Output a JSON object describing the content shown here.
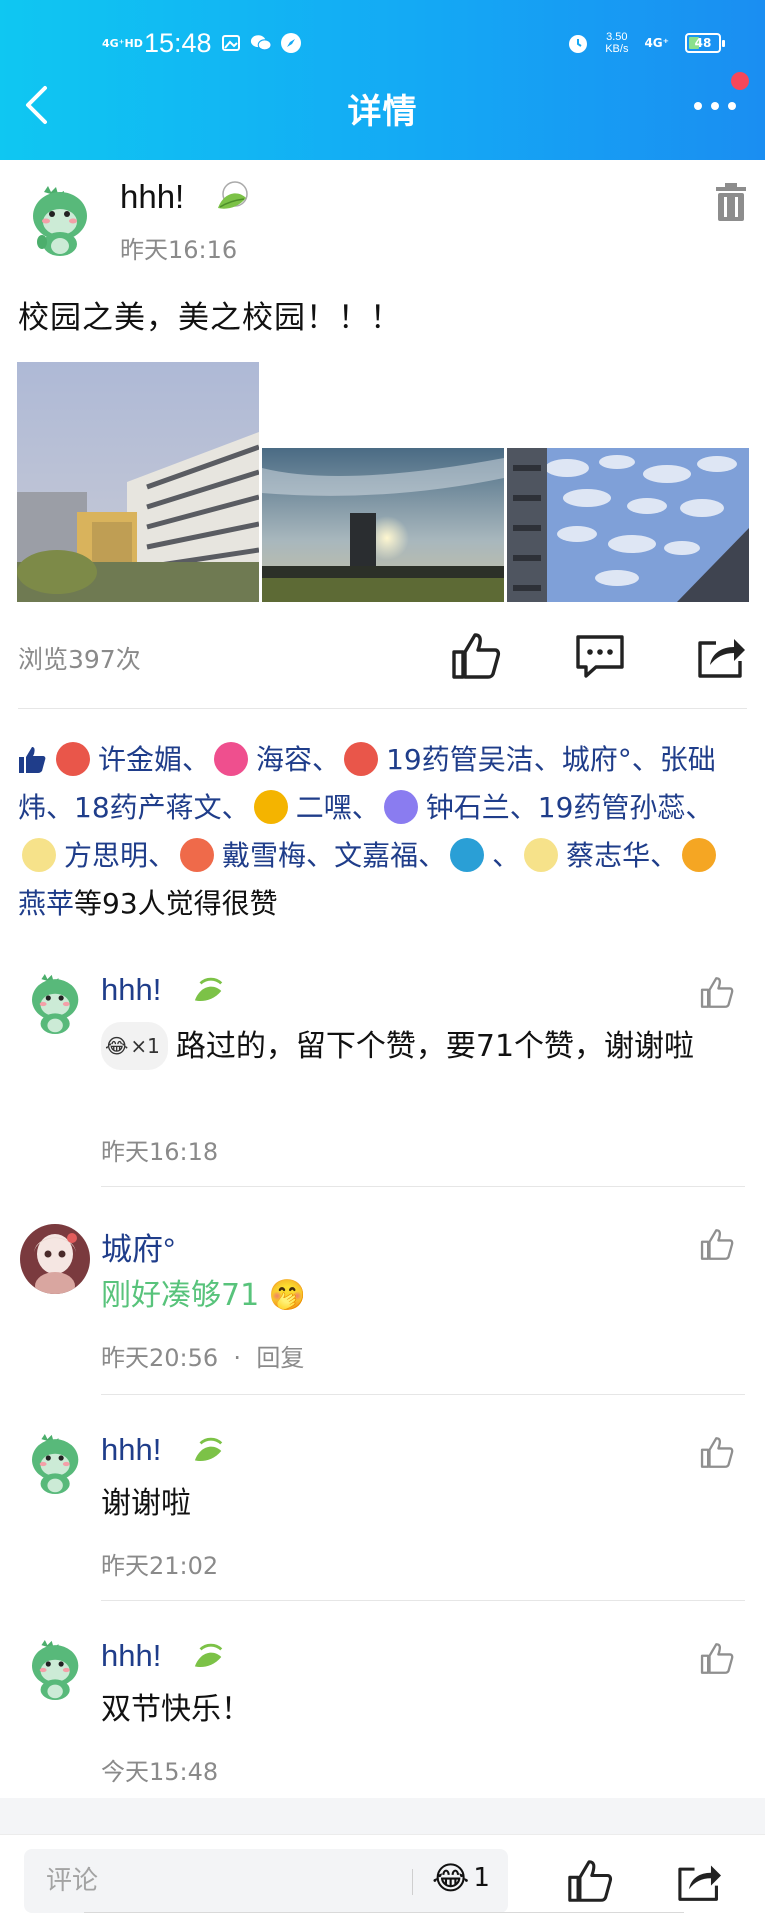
{
  "status_bar": {
    "signal": "4G⁺HD",
    "time": "15:48",
    "speed_value": "3.50",
    "speed_unit": "KB/s",
    "network": "4G⁺",
    "battery": "48"
  },
  "nav": {
    "title": "详情",
    "back_icon": "chevron-left-icon",
    "more_icon": "more-dots-icon",
    "has_notification_dot": true
  },
  "colors": {
    "header_gradient": [
      "#0fc7f2",
      "#1a8ef2"
    ],
    "link_blue": "#1f3d8a",
    "green_comment": "#58c37b",
    "notification_red": "#f6475a",
    "meta_gray": "#8a8a8a"
  },
  "post": {
    "author": "hhh!",
    "time": "昨天16:16",
    "text": "校园之美，美之校园！！！",
    "photo_count": 3,
    "views": "浏览397次"
  },
  "likes": {
    "names": [
      {
        "name": "许金媚",
        "avatar_color": "#e9564a"
      },
      {
        "name": "海容",
        "avatar_color": "#ef4f8e"
      },
      {
        "name": "19药管吴洁",
        "avatar_color": "#e9564a"
      },
      {
        "name": "城府°",
        "avatar_color": ""
      },
      {
        "name": "张础炜",
        "avatar_color": ""
      },
      {
        "name": "18药产蒋文",
        "avatar_color": ""
      },
      {
        "name": "二嘿",
        "avatar_color": "#f4b400"
      },
      {
        "name": "钟石兰",
        "avatar_color": "#8a7cf0"
      },
      {
        "name": "19药管孙蕊",
        "avatar_color": ""
      },
      {
        "name": "方思明",
        "avatar_color": "#f6e28a"
      },
      {
        "name": "戴雪梅",
        "avatar_color": "#ef6a4a"
      },
      {
        "name": "文嘉福",
        "avatar_color": ""
      },
      {
        "name": "",
        "avatar_color": "#2a9fd6"
      },
      {
        "name": "蔡志华",
        "avatar_color": "#f6e28a"
      },
      {
        "name": "燕苹",
        "avatar_color": "#f5a623"
      }
    ],
    "tail": "等93人觉得很赞"
  },
  "comments": [
    {
      "name": "hhh!",
      "emoji_count": "×1",
      "text": "路过的，留下个赞，要71个赞，谢谢啦",
      "time": "昨天16:18"
    },
    {
      "name": "城府°",
      "text": "刚好凑够71",
      "time": "昨天20:56",
      "reply": "回复"
    },
    {
      "name": "hhh!",
      "text": "谢谢啦",
      "time": "昨天21:02"
    },
    {
      "name": "hhh!",
      "text": "双节快乐！",
      "time": "今天15:48"
    }
  ],
  "bottom_bar": {
    "placeholder": "评论",
    "emoji_count": "1"
  }
}
